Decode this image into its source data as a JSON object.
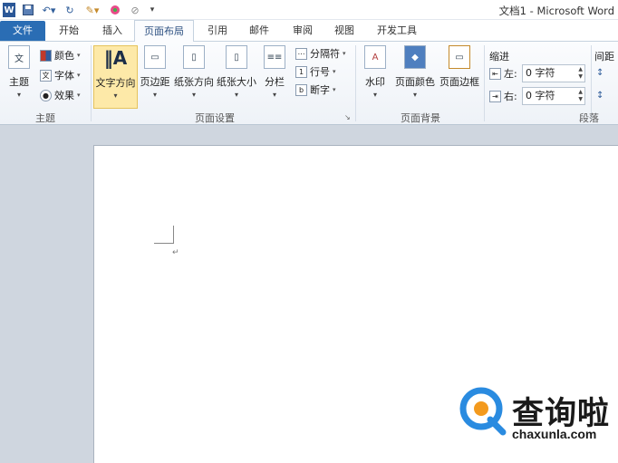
{
  "window": {
    "title": "文档1 - Microsoft Word"
  },
  "quick_access": {
    "app_icon": "W",
    "undo_icon": "undo-icon",
    "redo_icon": "redo-icon"
  },
  "tabs": [
    "文件",
    "开始",
    "插入",
    "页面布局",
    "引用",
    "邮件",
    "审阅",
    "视图",
    "开发工具"
  ],
  "active_tab": "页面布局",
  "ribbon": {
    "theme": {
      "label": "主题",
      "big_label": "主题",
      "items": [
        "颜色",
        "字体",
        "效果"
      ]
    },
    "page_setup": {
      "label": "页面设置",
      "big_items": [
        "文字方向",
        "页边距",
        "纸张方向",
        "纸张大小",
        "分栏"
      ],
      "small_items": [
        "分隔符",
        "行号",
        "断字"
      ]
    },
    "page_background": {
      "label": "页面背景",
      "big_items": [
        "水印",
        "页面颜色",
        "页面边框"
      ]
    },
    "paragraph": {
      "label": "段落",
      "indent_title": "缩进",
      "left_label": "左:",
      "left_value": "0 字符",
      "right_label": "右:",
      "right_value": "0 字符",
      "spacing_title": "间距"
    }
  },
  "watermark": {
    "brand": "查询啦",
    "url": "chaxunla.com"
  },
  "colors": {
    "file_tab": "#2a6db4",
    "page": "#ffffff",
    "workspace": "#cfd6df",
    "logo_blue": "#2a8be0",
    "logo_orange": "#f39a1e"
  }
}
